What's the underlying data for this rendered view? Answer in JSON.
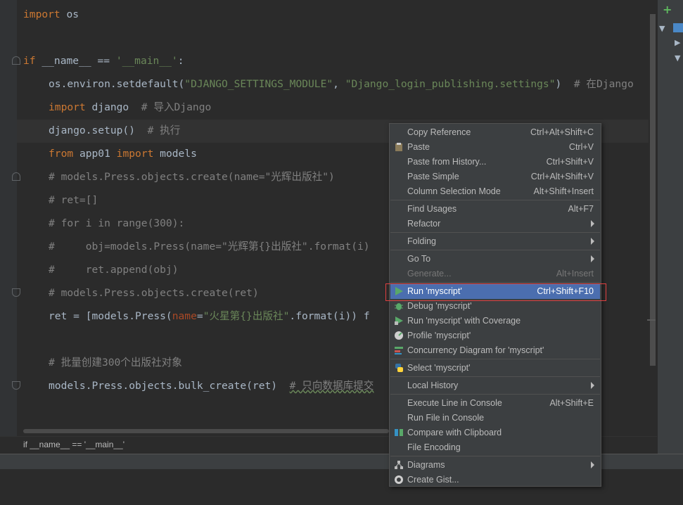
{
  "colors": {
    "editor_bg": "#2b2b2b",
    "keyword": "#cc7832",
    "string": "#6a8759",
    "comment": "#808080",
    "menu_bg": "#3c3f41",
    "menu_selected": "#4b6eaf",
    "annotation_box": "#e04040"
  },
  "code": {
    "l1": {
      "kw": "import",
      "rest": " os"
    },
    "l3": {
      "kw": "if",
      "rest": " __name__ == ",
      "str": "'__main__'",
      "end": ":"
    },
    "l4": {
      "a": "os.environ.setdefault(",
      "s1": "\"DJANGO_SETTINGS_MODULE\"",
      "b": ", ",
      "s2": "\"Django_login_publishing.settings\"",
      "c": ")  ",
      "cm": "# 在Django"
    },
    "l5": {
      "kw": "import",
      "rest": " django  ",
      "cm": "# 导入Django"
    },
    "l6": {
      "rest": "django.setup()  ",
      "cm": "# 执行"
    },
    "l7": {
      "kw1": "from",
      "mid": " app01 ",
      "kw2": "import",
      "rest": " models"
    },
    "l8": {
      "cm": "# models.Press.objects.create(name=\"光辉出版社\")"
    },
    "l9": {
      "cm": "# ret=[]"
    },
    "l10": {
      "cm": "# for i in range(300):"
    },
    "l11": {
      "cm": "#     obj=models.Press(name=\"光辉第{}出版社\".format(i)"
    },
    "l12": {
      "cm": "#     ret.append(obj)"
    },
    "l13": {
      "cm": "# models.Press.objects.create(ret)"
    },
    "l14": {
      "a": "ret = [models.Press(",
      "param": "name",
      "eq": "=",
      "str": "\"火星第{}出版社\"",
      "rest": ".format(i)) f"
    },
    "l16": {
      "cm": "# 批量创建300个出版社对象"
    },
    "l17": {
      "rest": "models.Press.objects.bulk_create(ret)  ",
      "cm": "# 只向数据库提交"
    }
  },
  "breadcrumb": "if __name__ == '__main__'",
  "menu": {
    "items": [
      {
        "label": "Copy Reference",
        "shortcut": "Ctrl+Alt+Shift+C"
      },
      {
        "label": "Paste",
        "shortcut": "Ctrl+V",
        "icon": "clipboard-icon"
      },
      {
        "label": "Paste from History...",
        "shortcut": "Ctrl+Shift+V"
      },
      {
        "label": "Paste Simple",
        "shortcut": "Ctrl+Alt+Shift+V"
      },
      {
        "label": "Column Selection Mode",
        "shortcut": "Alt+Shift+Insert"
      },
      {
        "label": "Find Usages",
        "shortcut": "Alt+F7"
      },
      {
        "label": "Refactor",
        "shortcut": ""
      },
      {
        "label": "Folding",
        "shortcut": ""
      },
      {
        "label": "Go To",
        "shortcut": ""
      },
      {
        "label": "Generate...",
        "shortcut": "Alt+Insert"
      },
      {
        "label": "Run 'myscript'",
        "shortcut": "Ctrl+Shift+F10",
        "icon": "run-icon"
      },
      {
        "label": "Debug 'myscript'",
        "shortcut": "",
        "icon": "debug-icon"
      },
      {
        "label": "Run 'myscript' with Coverage",
        "shortcut": "",
        "icon": "coverage-icon"
      },
      {
        "label": "Profile 'myscript'",
        "shortcut": "",
        "icon": "profile-icon"
      },
      {
        "label": "Concurrency Diagram for 'myscript'",
        "shortcut": "",
        "icon": "concurrency-icon"
      },
      {
        "label": "Select 'myscript'",
        "shortcut": "",
        "icon": "python-icon"
      },
      {
        "label": "Local History",
        "shortcut": ""
      },
      {
        "label": "Execute Line in Console",
        "shortcut": "Alt+Shift+E"
      },
      {
        "label": "Run File in Console",
        "shortcut": ""
      },
      {
        "label": "Compare with Clipboard",
        "shortcut": "",
        "icon": "compare-icon"
      },
      {
        "label": "File Encoding",
        "shortcut": ""
      },
      {
        "label": "Diagrams",
        "shortcut": "",
        "icon": "diagram-icon"
      },
      {
        "label": "Create Gist...",
        "shortcut": "",
        "icon": "github-icon"
      }
    ]
  }
}
